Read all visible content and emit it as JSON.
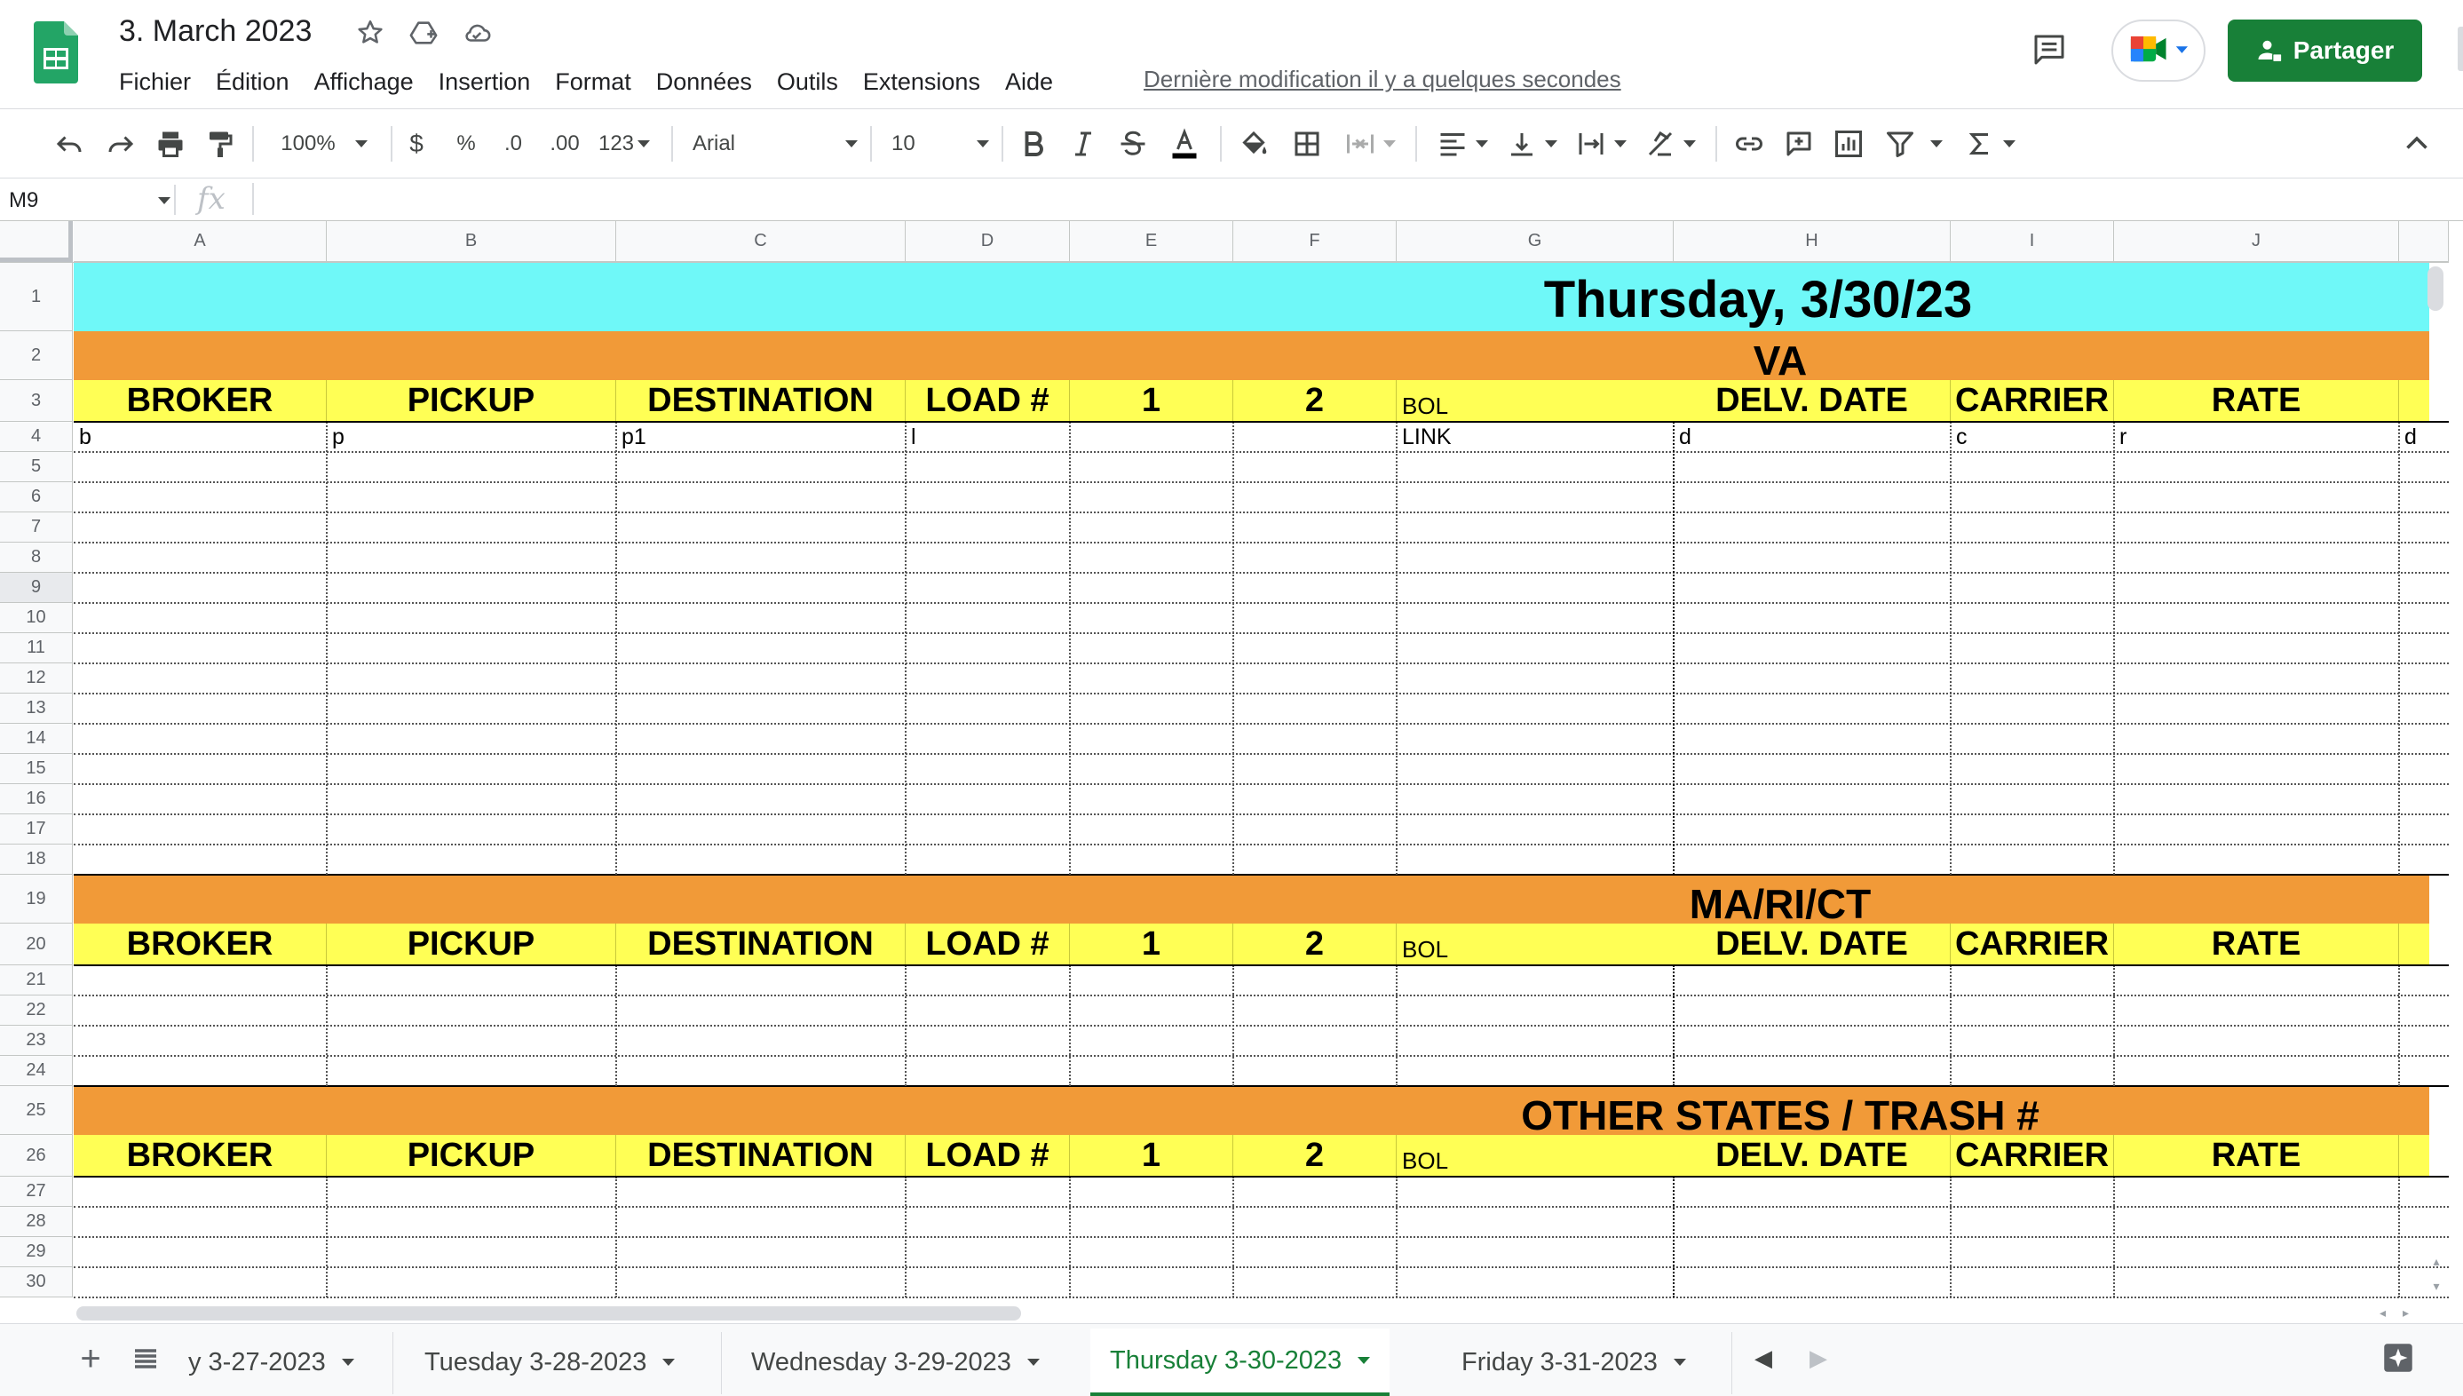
{
  "app": {
    "doc_title": "3. March 2023",
    "menus": [
      "Fichier",
      "Édition",
      "Affichage",
      "Insertion",
      "Format",
      "Données",
      "Outils",
      "Extensions",
      "Aide"
    ],
    "last_edit": "Dernière modification il y a quelques secondes",
    "share_label": "Partager",
    "colors": {
      "share_green": "#188038",
      "sheets_green": "#23a566"
    }
  },
  "toolbar": {
    "zoom": "100%",
    "currency": "$",
    "percent": "%",
    "decrease_decimal": ".0",
    "increase_decimal": ".00",
    "number_format": "123",
    "font": "Arial",
    "font_size": "10"
  },
  "formula_bar": {
    "name_box": "M9",
    "fx": "fx",
    "value": ""
  },
  "grid": {
    "columns": [
      "A",
      "B",
      "C",
      "D",
      "E",
      "F",
      "G",
      "H",
      "I",
      "J"
    ],
    "rows": [
      "1",
      "2",
      "3",
      "4",
      "5",
      "6",
      "7",
      "8",
      "9",
      "10",
      "11",
      "12",
      "13",
      "14",
      "15",
      "16",
      "17",
      "18",
      "19",
      "20",
      "21",
      "22",
      "23",
      "24",
      "25",
      "26",
      "27",
      "28",
      "29",
      "30"
    ],
    "selected_row": "9",
    "title": "Thursday, 3/30/23",
    "sections": [
      {
        "label": "VA"
      },
      {
        "label": "MA/RI/CT"
      },
      {
        "label": "OTHER STATES / TRASH #"
      }
    ],
    "header_labels": {
      "broker": "BROKER",
      "pickup": "PICKUP",
      "destination": "DESTINATION",
      "load": "LOAD #",
      "one": "1",
      "two": "2",
      "bol": "BOL",
      "delv_date": "DELV. DATE",
      "carrier": "CARRIER",
      "rate": "RATE"
    },
    "row4": {
      "broker": "b",
      "pickup": "p",
      "destination": "p1",
      "load": "l",
      "bol": "LINK",
      "delv_date": "d",
      "carrier": "c",
      "rate": "r",
      "k": "d"
    },
    "colors": {
      "title_band": "#6ff8f8",
      "section_band": "#f19a38",
      "header_band": "#ffff55"
    }
  },
  "sheets": {
    "tabs": [
      "y 3-27-2023",
      "Tuesday 3-28-2023",
      "Wednesday 3-29-2023",
      "Thursday 3-30-2023",
      "Friday 3-31-2023"
    ],
    "active": "Thursday 3-30-2023"
  }
}
